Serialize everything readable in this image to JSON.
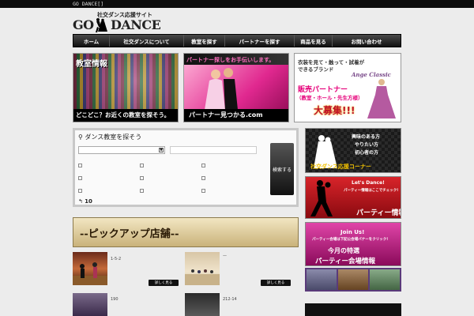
{
  "topbar": {
    "text": "GO DANCE[]"
  },
  "logo": {
    "tagline": "社交ダンス応援サイト",
    "go": "GO",
    "dance": "DANCE"
  },
  "nav": {
    "items": [
      {
        "label": "ホーム"
      },
      {
        "label": "社交ダンスについて"
      },
      {
        "label": "教室を探す"
      },
      {
        "label": "パートナーを探す"
      },
      {
        "label": "商品を見る"
      },
      {
        "label": "お問い合わせ"
      }
    ]
  },
  "banners": {
    "classroom": {
      "title": "教室情報",
      "caption": "どこどこ？お近くの教室を探そう。"
    },
    "partner": {
      "title": "パートナー探しをお手伝いします。",
      "caption": "パートナー見つかる.com"
    },
    "shop": {
      "headline1": "衣装を見て・触って・試着が",
      "headline2": "できるブランド",
      "brand": "Ange Classic",
      "sub1": "販売パートナー",
      "sub2": "（教室・ホール・先生方様）",
      "cta": "大募集!!!"
    }
  },
  "search": {
    "heading": "ダンス教室を探そう",
    "button_label": "検索する",
    "count": "10"
  },
  "pickup": {
    "title": "--ピックアップ店舗--"
  },
  "shops": [
    {
      "text": "1-5-2",
      "button": "詳しく見る"
    },
    {
      "text": "—",
      "button": "詳しく見る"
    },
    {
      "text": "190",
      "button": ""
    },
    {
      "text": "212-14",
      "button": ""
    }
  ],
  "side": {
    "beginner": {
      "line1": "興味のある方",
      "line2": "やりたい方",
      "line3": "初心者の方",
      "title": "社交ダンス応援コーナー"
    },
    "party": {
      "top": "Let's Dance!",
      "small": "パーティー情報はここでチェック!",
      "title": "パーティー情報"
    },
    "venue": {
      "top": "Join Us!",
      "small": "パーティー会場は下記公会場バナーをクリック!",
      "title1": "今月の特選",
      "title2": "パーティー会場情報"
    }
  },
  "colors": {
    "nav_bg": "#1a1a1a",
    "partner_pink": "#e0288f",
    "party_red": "#b3141c",
    "venue_magenta": "#c2157f",
    "shop_red": "#c0102a",
    "gold": "#f2c100"
  }
}
